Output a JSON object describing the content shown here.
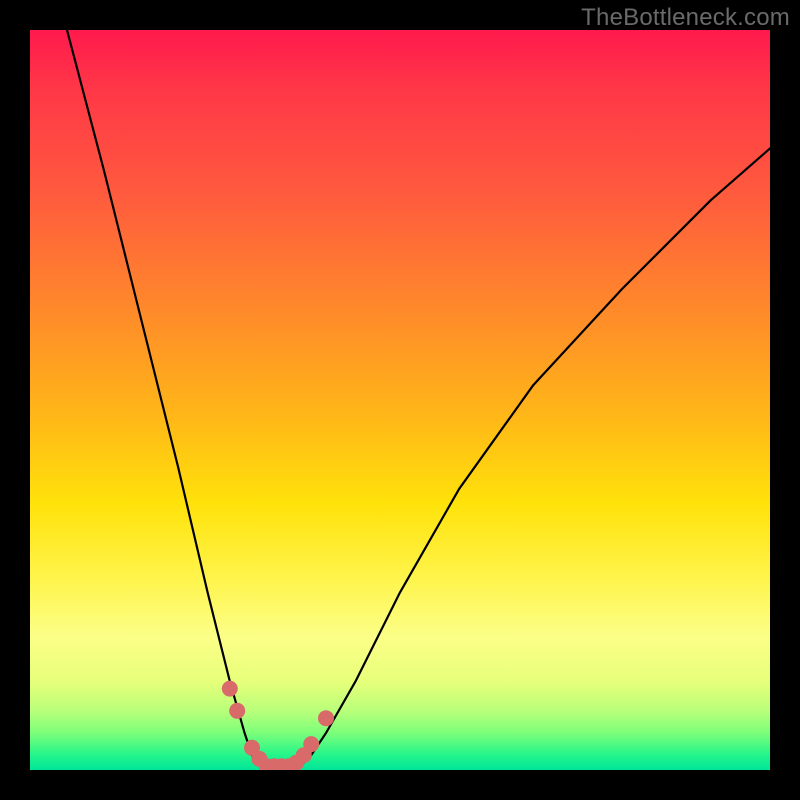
{
  "watermark": "TheBottleneck.com",
  "chart_data": {
    "type": "line",
    "title": "",
    "xlabel": "",
    "ylabel": "",
    "xlim": [
      0,
      100
    ],
    "ylim": [
      0,
      100
    ],
    "grid": false,
    "legend": false,
    "series": [
      {
        "name": "bottleneck-curve",
        "x": [
          5,
          10,
          15,
          20,
          24,
          27,
          29,
          30,
          31,
          32,
          33,
          34,
          35,
          36,
          37,
          38,
          40,
          44,
          50,
          58,
          68,
          80,
          92,
          100
        ],
        "values": [
          100,
          81,
          61,
          41,
          24,
          12,
          5,
          2,
          1,
          0,
          0,
          0,
          0,
          0,
          1,
          2,
          5,
          12,
          24,
          38,
          52,
          65,
          77,
          84
        ]
      }
    ],
    "markers": {
      "name": "highlight-points",
      "color": "#d86a6a",
      "x": [
        27,
        28,
        30,
        31,
        32,
        33,
        34,
        35,
        36,
        37,
        38,
        40
      ],
      "values": [
        11,
        8,
        3,
        1.5,
        0.5,
        0.5,
        0.5,
        0.5,
        1,
        2,
        3.5,
        7
      ]
    },
    "gradient_stops": [
      {
        "pos": 0.0,
        "color": "#ff1a4d"
      },
      {
        "pos": 0.22,
        "color": "#ff5a3e"
      },
      {
        "pos": 0.52,
        "color": "#ffb618"
      },
      {
        "pos": 0.74,
        "color": "#fff44b"
      },
      {
        "pos": 0.92,
        "color": "#b9ff7a"
      },
      {
        "pos": 1.0,
        "color": "#00e59a"
      }
    ]
  }
}
